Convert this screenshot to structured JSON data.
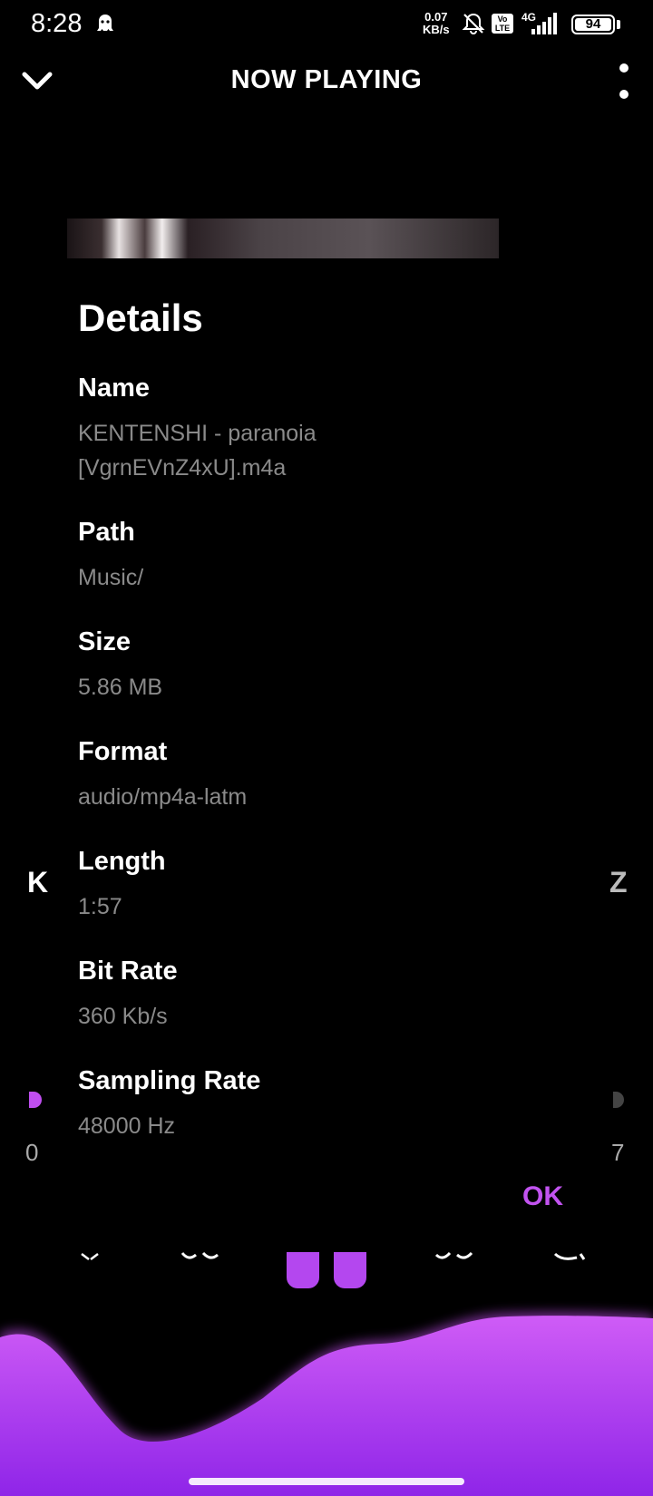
{
  "status_bar": {
    "time": "8:28",
    "net_speed_value": "0.07",
    "net_speed_unit": "KB/s",
    "volte_label_1": "Vo",
    "volte_label_2": "LTE",
    "network_type": "4G",
    "battery": "94"
  },
  "header": {
    "title": "NOW PLAYING"
  },
  "player_background": {
    "left_char": "K",
    "right_char": "Z",
    "time_start": "0",
    "time_end": "7"
  },
  "dialog": {
    "title": "Details",
    "fields": [
      {
        "label": "Name",
        "value": "KENTENSHI - paranoia [VgrnEVnZ4xU].m4a"
      },
      {
        "label": "Path",
        "value": "Music/"
      },
      {
        "label": "Size",
        "value": "5.86 MB"
      },
      {
        "label": "Format",
        "value": "audio/mp4a-latm"
      },
      {
        "label": "Length",
        "value": "1:57"
      },
      {
        "label": "Bit Rate",
        "value": "360 Kb/s"
      },
      {
        "label": "Sampling Rate",
        "value": "48000 Hz"
      }
    ],
    "ok_label": "OK"
  },
  "colors": {
    "accent": "#c253f0",
    "background": "#000000",
    "value_text": "#8a8a8a"
  }
}
